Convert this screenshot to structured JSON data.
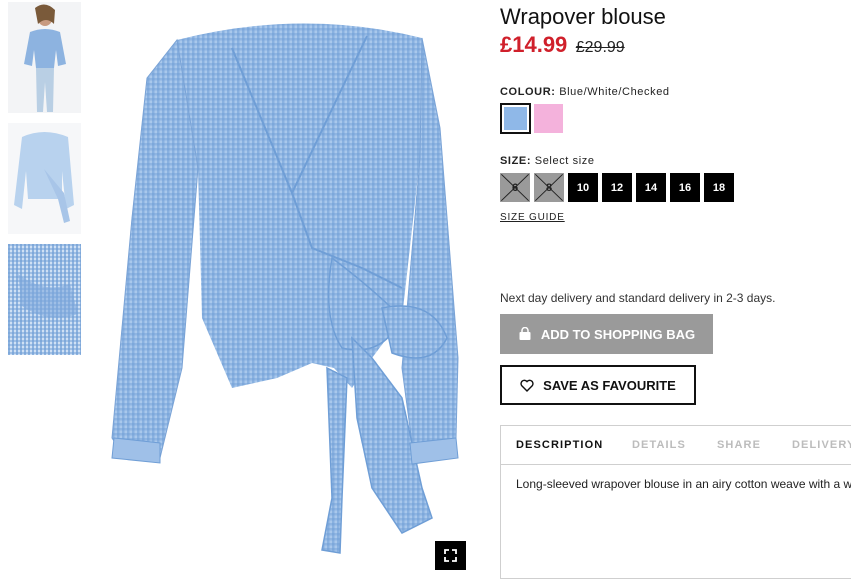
{
  "product": {
    "title": "Wrapover blouse",
    "price_now": "£14.99",
    "price_old": "£29.99"
  },
  "colour": {
    "label": "COLOUR:",
    "value": "Blue/White/Checked",
    "swatches": [
      {
        "name": "blue",
        "color": "#8fb8e8",
        "selected": true
      },
      {
        "name": "pink",
        "color": "#f4b2dc",
        "selected": false
      }
    ]
  },
  "size": {
    "label": "SIZE:",
    "value": "Select size",
    "options": [
      {
        "label": "6",
        "available": false
      },
      {
        "label": "8",
        "available": false
      },
      {
        "label": "10",
        "available": true
      },
      {
        "label": "12",
        "available": true
      },
      {
        "label": "14",
        "available": true
      },
      {
        "label": "16",
        "available": true
      },
      {
        "label": "18",
        "available": true
      }
    ],
    "guide": "SIZE GUIDE"
  },
  "delivery": "Next day delivery and standard delivery in 2-3 days.",
  "actions": {
    "add_to_bag": "ADD TO SHOPPING BAG",
    "add_to_bag_icon": "shopping-bag-icon",
    "save": "SAVE AS FAVOURITE",
    "save_icon": "heart-icon"
  },
  "tabs": [
    {
      "label": "DESCRIPTION",
      "active": true
    },
    {
      "label": "DETAILS",
      "active": false
    },
    {
      "label": "SHARE",
      "active": false
    },
    {
      "label": "DELIVERY",
      "active": false
    }
  ],
  "description": "Long-sleeved wrapover blouse in an airy cotton weave with a w",
  "gallery": {
    "fullscreen_icon": "expand-icon",
    "colors": {
      "blouse": "#8db3e0",
      "check": "#6f9ed6",
      "accent_red": "#d0202b"
    }
  }
}
